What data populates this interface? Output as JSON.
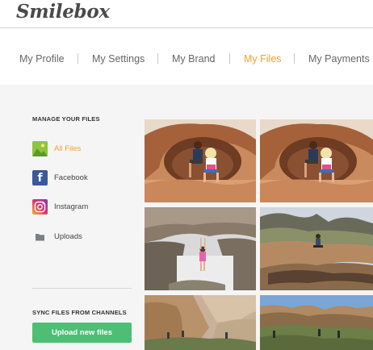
{
  "header": {
    "logo_text": "Smilebox"
  },
  "nav": {
    "items": [
      {
        "label": "My Profile"
      },
      {
        "label": "My Settings"
      },
      {
        "label": "My Brand"
      },
      {
        "label": "My Files"
      },
      {
        "label": "My Payments"
      }
    ],
    "active_index": 3
  },
  "sidebar": {
    "manage_title": "MANAGE YOUR FILES",
    "items": [
      {
        "label": "All Files",
        "icon": "image-icon"
      },
      {
        "label": "Facebook",
        "icon": "facebook-icon"
      },
      {
        "label": "Instagram",
        "icon": "instagram-icon"
      },
      {
        "label": "Uploads",
        "icon": "folder-icon"
      }
    ],
    "active_index": 0,
    "sync_title": "SYNC FILES FROM CHANNELS",
    "upload_button": "Upload new files"
  },
  "colors": {
    "accent": "#f0a030",
    "upload_button": "#4cbf74",
    "facebook": "#3b5998",
    "content_bg": "#f5f5f5"
  },
  "gallery": {
    "photos": [
      {
        "scene": "sandstone-arch-two-kids"
      },
      {
        "scene": "sandstone-arch-two-kids"
      },
      {
        "scene": "canyon-overhang-girl-pink"
      },
      {
        "scene": "rock-ledge-person-sitting"
      },
      {
        "scene": "canyon-cliff-hikers"
      },
      {
        "scene": "canyon-valley-hikers"
      }
    ]
  }
}
